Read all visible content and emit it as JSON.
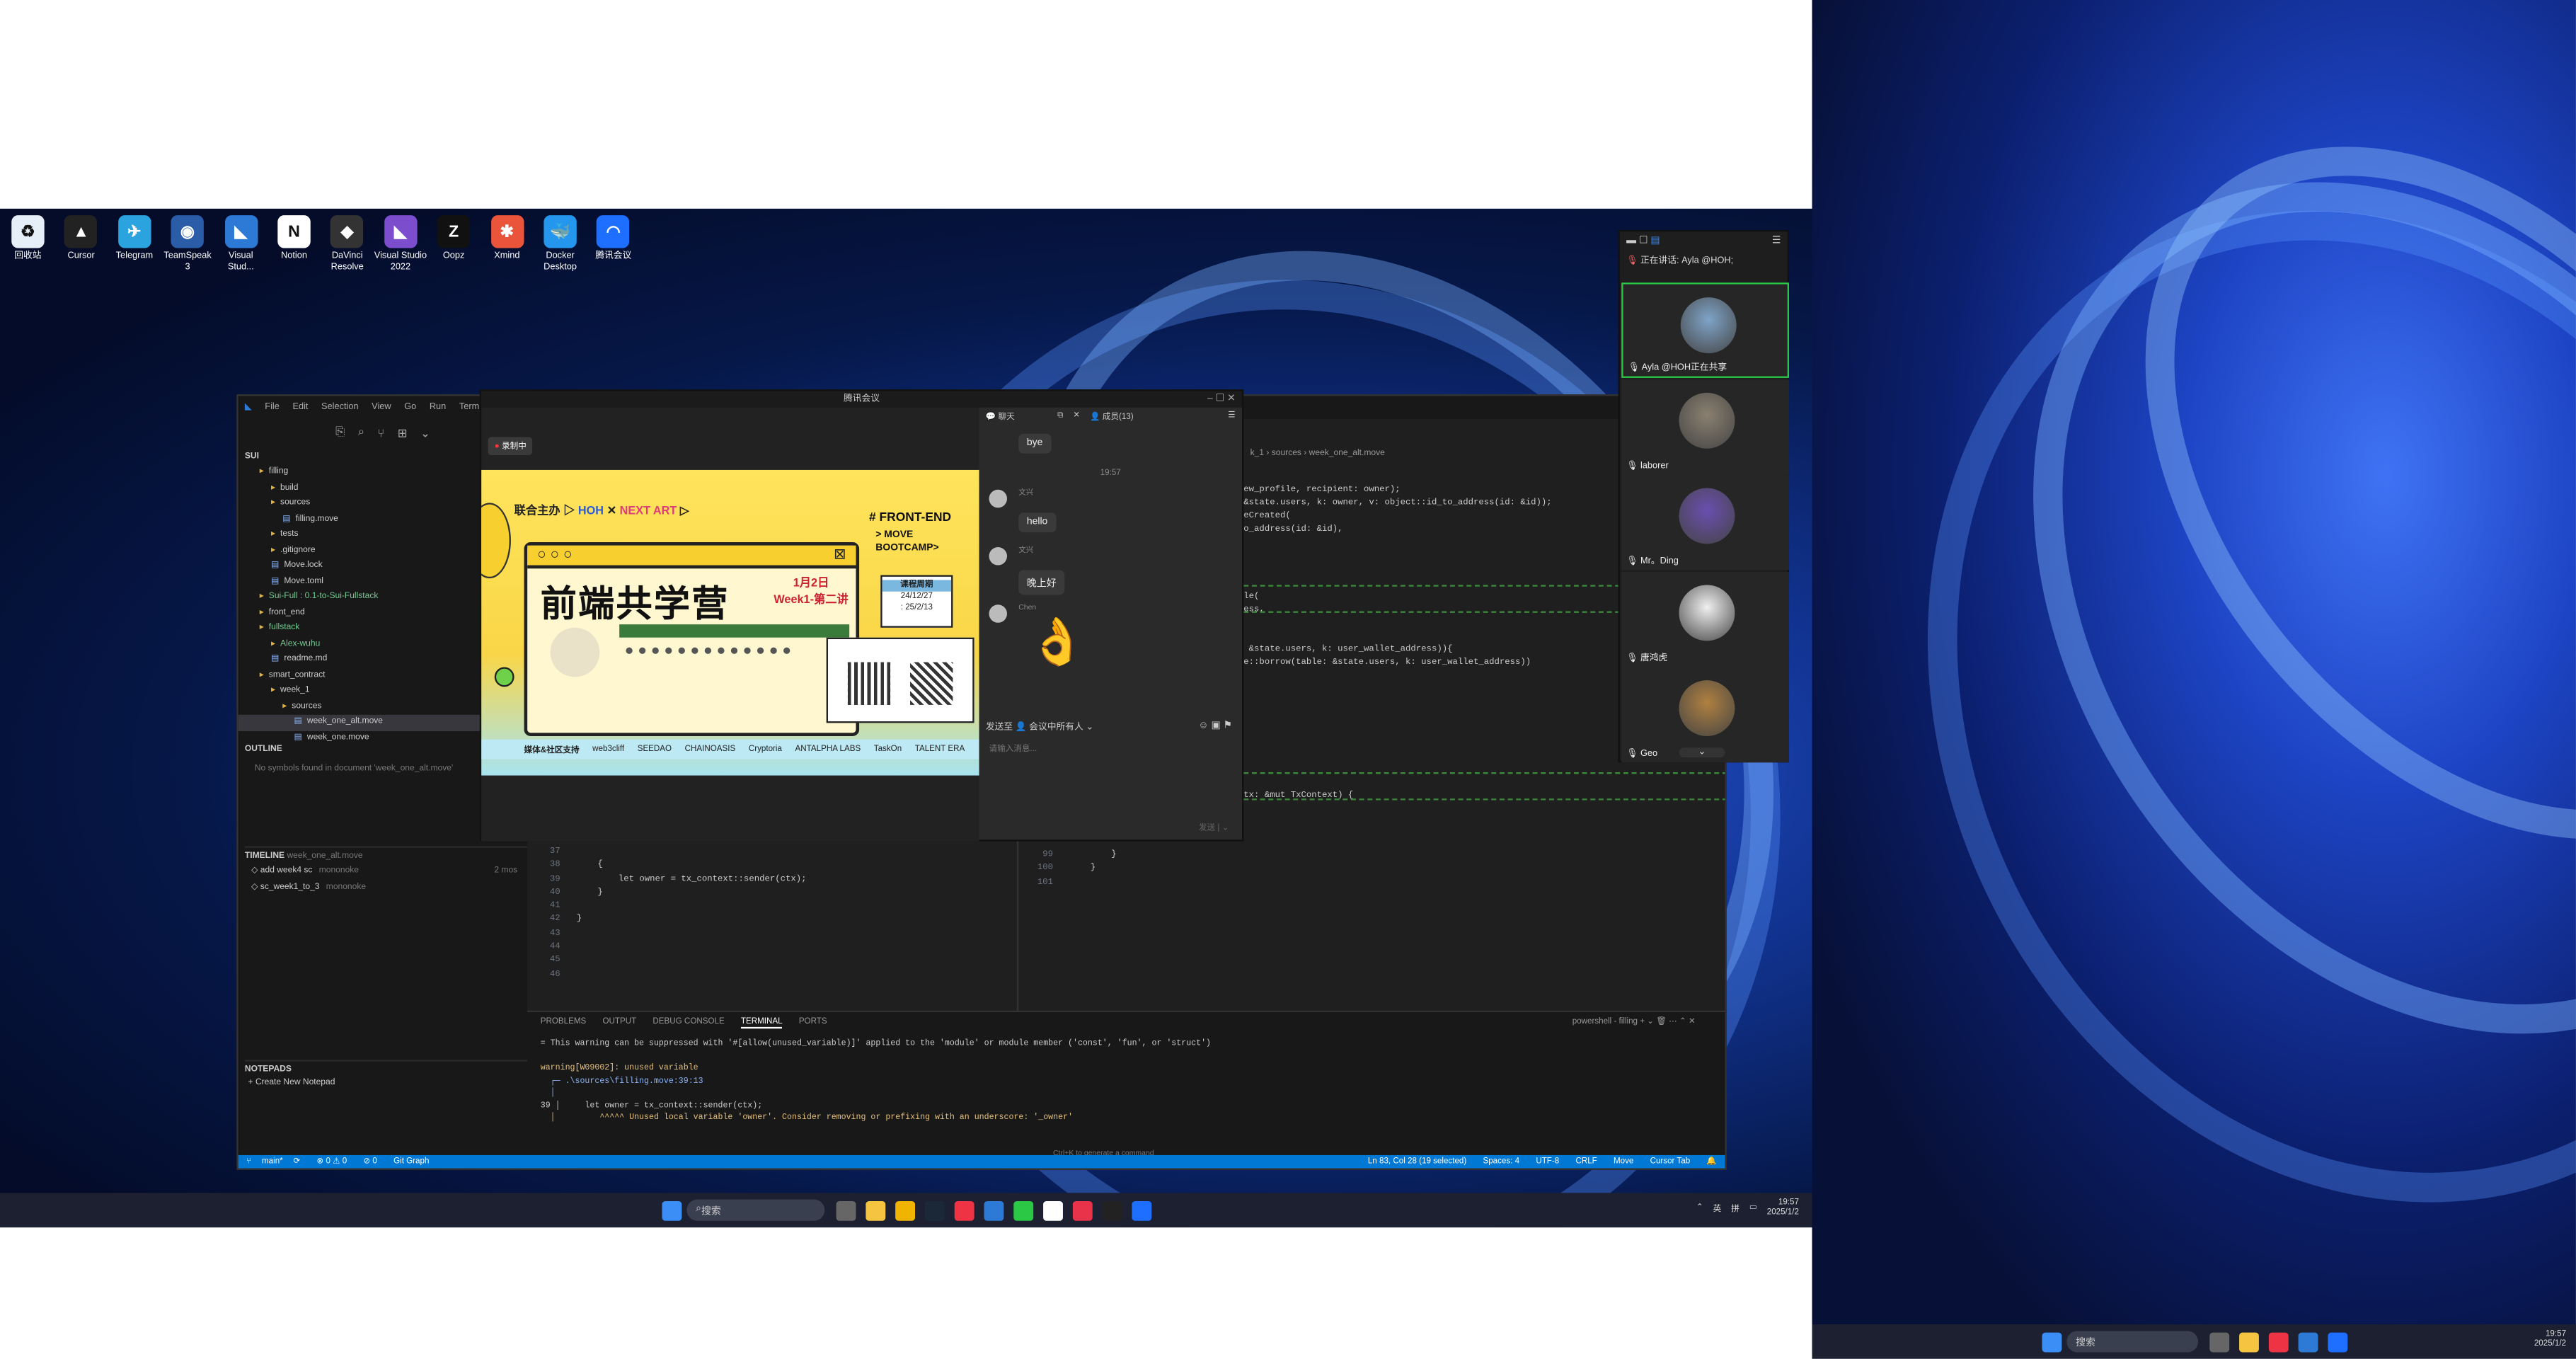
{
  "desktop_icons": [
    {
      "label": "回收站",
      "color": "#e6eef8",
      "glyph": "♻"
    },
    {
      "label": "Cursor",
      "color": "#222",
      "glyph": "▲"
    },
    {
      "label": "Telegram",
      "color": "#2aa3df",
      "glyph": "✈"
    },
    {
      "label": "TeamSpeak 3",
      "color": "#2b5ca8",
      "glyph": "◉"
    },
    {
      "label": "Visual Stud...",
      "color": "#2d7ad6",
      "glyph": "◣"
    },
    {
      "label": "Notion",
      "color": "#fff",
      "glyph": "N"
    },
    {
      "label": "DaVinci Resolve",
      "color": "#333",
      "glyph": "◆"
    },
    {
      "label": "Visual Studio 2022",
      "color": "#7c4dcc",
      "glyph": "◣"
    },
    {
      "label": "Oopz",
      "color": "#111",
      "glyph": "Z"
    },
    {
      "label": "Xmind",
      "color": "#e9543a",
      "glyph": "✱"
    },
    {
      "label": "Docker Desktop",
      "color": "#2496ed",
      "glyph": "🐳"
    },
    {
      "label": "腾讯会议",
      "color": "#1e6fff",
      "glyph": "◠"
    }
  ],
  "vscode": {
    "menu": [
      "Selection",
      "View",
      "Go",
      "Run",
      "Termin"
    ],
    "menu_first": [
      "File",
      "Edit"
    ],
    "explorer_root": "SUI",
    "tree": [
      {
        "label": "filling",
        "indent": 1,
        "color": "#ccc"
      },
      {
        "label": "build",
        "indent": 2,
        "color": "#ccc"
      },
      {
        "label": "sources",
        "indent": 2,
        "color": "#ccc"
      },
      {
        "label": "filling.move",
        "indent": 3,
        "color": "#ccc"
      },
      {
        "label": "tests",
        "indent": 2,
        "color": "#ccc"
      },
      {
        "label": ".gitignore",
        "indent": 2,
        "color": "#ccc"
      },
      {
        "label": "Move.lock",
        "indent": 2,
        "color": "#ccc"
      },
      {
        "label": "Move.toml",
        "indent": 2,
        "color": "#ccc"
      },
      {
        "label": "Sui-Full : 0.1-to-Sui-Fullstack",
        "indent": 1,
        "color": "#73c991"
      },
      {
        "label": "front_end",
        "indent": 1,
        "color": "#ccc"
      },
      {
        "label": "fullstack",
        "indent": 1,
        "color": "#73c991"
      },
      {
        "label": "Alex-wuhu",
        "indent": 2,
        "color": "#73c991"
      },
      {
        "label": "readme.md",
        "indent": 2,
        "color": "#ccc"
      },
      {
        "label": "smart_contract",
        "indent": 1,
        "color": "#ccc"
      },
      {
        "label": "week_1",
        "indent": 2,
        "color": "#ccc"
      },
      {
        "label": "sources",
        "indent": 3,
        "color": "#ccc"
      },
      {
        "label": "week_one_alt.move",
        "indent": 4,
        "color": "#ccc"
      },
      {
        "label": "week_one.move",
        "indent": 4,
        "color": "#ccc"
      }
    ],
    "outline_title": "OUTLINE",
    "outline_empty": "No symbols found in document 'week_one_alt.move'",
    "timeline_title": "TIMELINE",
    "timeline_file": "week_one_alt.move",
    "timeline": [
      {
        "msg": "add week4 sc",
        "author": "mononoke",
        "time": "2 mos"
      },
      {
        "msg": "sc_week1_to_3",
        "author": "mononoke",
        "time": ""
      }
    ],
    "notepads_title": "NOTEPADS",
    "notepads_new": "Create New Notepad",
    "breadcrumb": [
      "k_1",
      "sources",
      "week_one_alt.move"
    ],
    "left_code": [
      {
        "n": "37",
        "t": ""
      },
      {
        "n": "38",
        "t": "    {"
      },
      {
        "n": "39",
        "t": "        let owner = tx_context::sender(ctx);"
      },
      {
        "n": "40",
        "t": "    }"
      },
      {
        "n": "41",
        "t": ""
      },
      {
        "n": "42",
        "t": "}"
      },
      {
        "n": "43",
        "t": ""
      },
      {
        "n": "44",
        "t": ""
      },
      {
        "n": "45",
        "t": ""
      },
      {
        "n": "46",
        "t": ""
      }
    ],
    "right_code": [
      "ew_profile, recipient: owner);",
      "&state.users, k: owner, v: object::id_to_address(id: &id));",
      "eCreated(",
      "o_address(id: &id),",
      "",
      "",
      "",
      "",
      "le(",
      "ess,",
      "",
      "",
      " &state.users, k: user_wallet_address)){",
      "e::borrow(table: &state.users, k: user_wallet_address))",
      "",
      "",
      "",
      "",
      "",
      "",
      "",
      "",
      "",
      "tx: &mut TxContext) {"
    ],
    "right_tail": [
      {
        "n": "99",
        "t": "        }"
      },
      {
        "n": "100",
        "t": "    }"
      },
      {
        "n": "101",
        "t": ""
      }
    ],
    "panel_tabs": [
      "PROBLEMS",
      "OUTPUT",
      "DEBUG CONSOLE",
      "TERMINAL",
      "PORTS"
    ],
    "panel_active": "TERMINAL",
    "terminal_name": "powershell - filling",
    "terminal": [
      {
        "t": "= This warning can be suppressed with '#[allow(unused_variable)]' applied to the 'module' or module member ('const', 'fun', or 'struct')",
        "c": "#ccc"
      },
      {
        "t": "",
        "c": "#ccc"
      },
      {
        "t": "warning[W09002]: unused variable",
        "c": "#e5c07b"
      },
      {
        "t": "  ┌─ .\\sources\\filling.move:39:13",
        "c": "#8ab4f8"
      },
      {
        "t": "  │",
        "c": "#8ab4f8"
      },
      {
        "t": "39 │     let owner = tx_context::sender(ctx);",
        "c": "#ccc"
      },
      {
        "t": "  │         ^^^^^ Unused local variable 'owner'. Consider removing or prefixing with an underscore: '_owner'",
        "c": "#e5c07b"
      }
    ],
    "terminal_hint": "Ctrl+K to generate a command",
    "status_left": [
      "main*",
      "⊗ 0 ⚠ 0",
      "⊘ 0",
      "Git Graph"
    ],
    "status_right": [
      "Ln 83, Col 28 (19 selected)",
      "Spaces: 4",
      "UTF-8",
      "CRLF",
      "Move",
      "Cursor Tab"
    ]
  },
  "meeting": {
    "title": "腾讯会议",
    "record": "录制中",
    "banner": {
      "top_left": "联合主办",
      "hoh": "HOH",
      "next_art": "NEXT ART",
      "front_end": "# FRONT-END",
      "move": "> MOVE",
      "bootcamp": "BOOTCAMP>",
      "title": "前端共学营",
      "date_main": "1月2日",
      "week": "Week1-第二讲",
      "course_period": "课程周期",
      "range1": "24/12/27",
      "range2": ": 25/2/13",
      "media": "媒体&社区支持",
      "partners": [
        "web3cliff",
        "SEEDAO",
        "CHAINOASIS",
        "Cryptoria",
        "ANTALPHA LABS",
        "TaskOn",
        "TALENT ERA"
      ]
    },
    "chat_tab": "聊天",
    "members_tab": "成员(13)",
    "time": "19:57",
    "messages": [
      {
        "sender": "",
        "text": "bye",
        "self": false
      },
      {
        "sender": "文兴",
        "text": "hello"
      },
      {
        "sender": "文兴",
        "text": "晚上好"
      },
      {
        "sender": "Chen",
        "text": "👌"
      }
    ],
    "send_to": "发送至",
    "send_target": "会议中所有人",
    "input_placeholder": "请输入消息...",
    "send_button": "发送"
  },
  "participants": {
    "speaking": "正在讲话:",
    "speaker": "Ayla @HOH;",
    "tiles": [
      {
        "name": "Ayla @HOH正在共享",
        "color": "#7fa4c8"
      },
      {
        "name": "laborer",
        "color": "#8a8070"
      },
      {
        "name": "Mr。Ding",
        "color": "#6a4fb0"
      },
      {
        "name": "唐鸿虎",
        "color": "#f0f0f0"
      },
      {
        "name": "Geo",
        "color": "#b08040"
      }
    ]
  },
  "taskbar": {
    "search": "搜索",
    "time": "19:57",
    "date": "2025/1/2",
    "ime1": "英",
    "ime2": "拼"
  }
}
